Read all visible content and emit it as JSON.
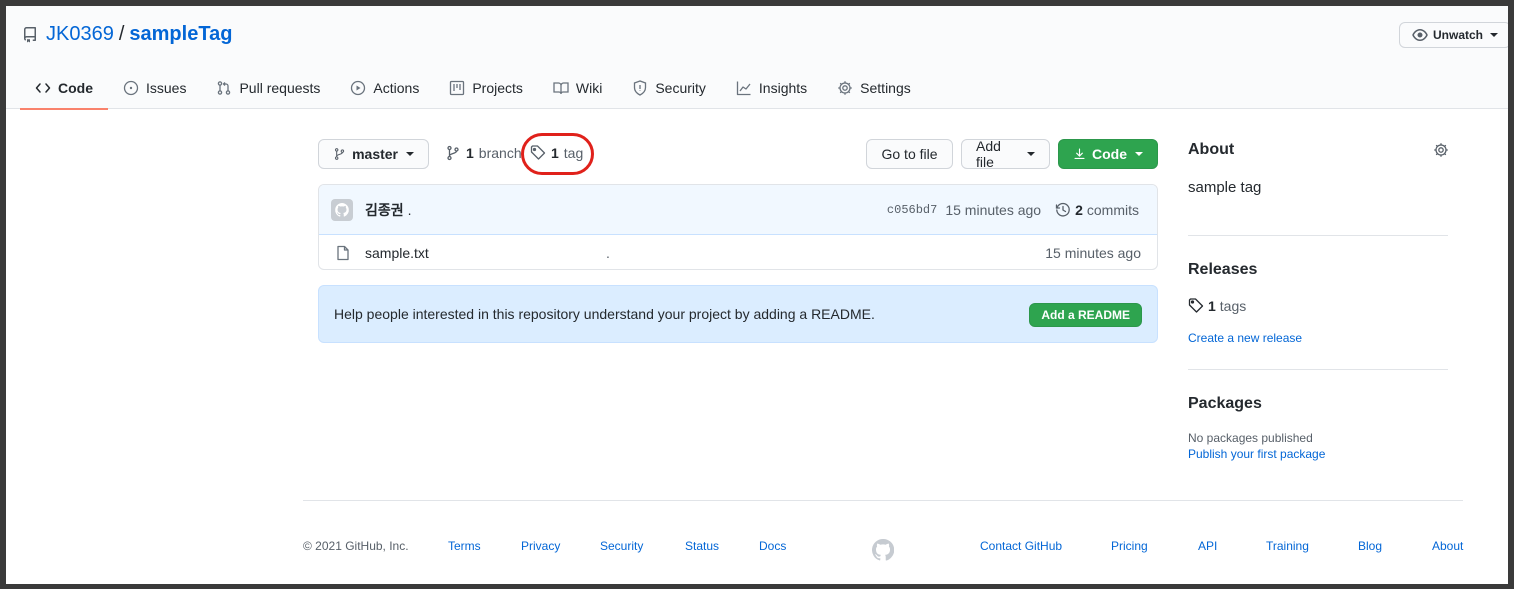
{
  "repo": {
    "owner": "JK0369",
    "separator": "/",
    "name": "sampleTag"
  },
  "watch": {
    "label": "Unwatch"
  },
  "tabs": [
    {
      "label": "Code",
      "icon": "code-icon"
    },
    {
      "label": "Issues",
      "icon": "issue-icon"
    },
    {
      "label": "Pull requests",
      "icon": "pull-request-icon"
    },
    {
      "label": "Actions",
      "icon": "play-icon"
    },
    {
      "label": "Projects",
      "icon": "project-icon"
    },
    {
      "label": "Wiki",
      "icon": "book-icon"
    },
    {
      "label": "Security",
      "icon": "shield-icon"
    },
    {
      "label": "Insights",
      "icon": "graph-icon"
    },
    {
      "label": "Settings",
      "icon": "gear-icon"
    }
  ],
  "toolbar": {
    "branch_select": "master",
    "branch_count": "1",
    "branch_label": "branch",
    "tag_count": "1",
    "tag_label": "tag",
    "go_to_file": "Go to file",
    "add_file": "Add file",
    "code": "Code"
  },
  "commit": {
    "author": "김종권",
    "message": ".",
    "sha": "c056bd7",
    "age": "15 minutes ago",
    "commit_count": "2",
    "commit_label": "commits"
  },
  "files": [
    {
      "name": "sample.txt",
      "message": ".",
      "age": "15 minutes ago"
    }
  ],
  "readme": {
    "text": "Help people interested in this repository understand your project by adding a README.",
    "button": "Add a README"
  },
  "sidebar": {
    "about_title": "About",
    "about_desc": "sample tag",
    "releases_title": "Releases",
    "tags_count": "1",
    "tags_label": "tags",
    "create_release": "Create a new release",
    "packages_title": "Packages",
    "no_packages": "No packages published",
    "publish_package": "Publish your first package"
  },
  "footer": {
    "copyright": "© 2021 GitHub, Inc.",
    "links": [
      "Terms",
      "Privacy",
      "Security",
      "Status",
      "Docs",
      "Contact GitHub",
      "Pricing",
      "API",
      "Training",
      "Blog",
      "About"
    ]
  },
  "colors": {
    "link": "#0366d6",
    "green": "#2ea44f",
    "highlight_circle": "#e0211b",
    "tab_underline": "#f9826c"
  }
}
